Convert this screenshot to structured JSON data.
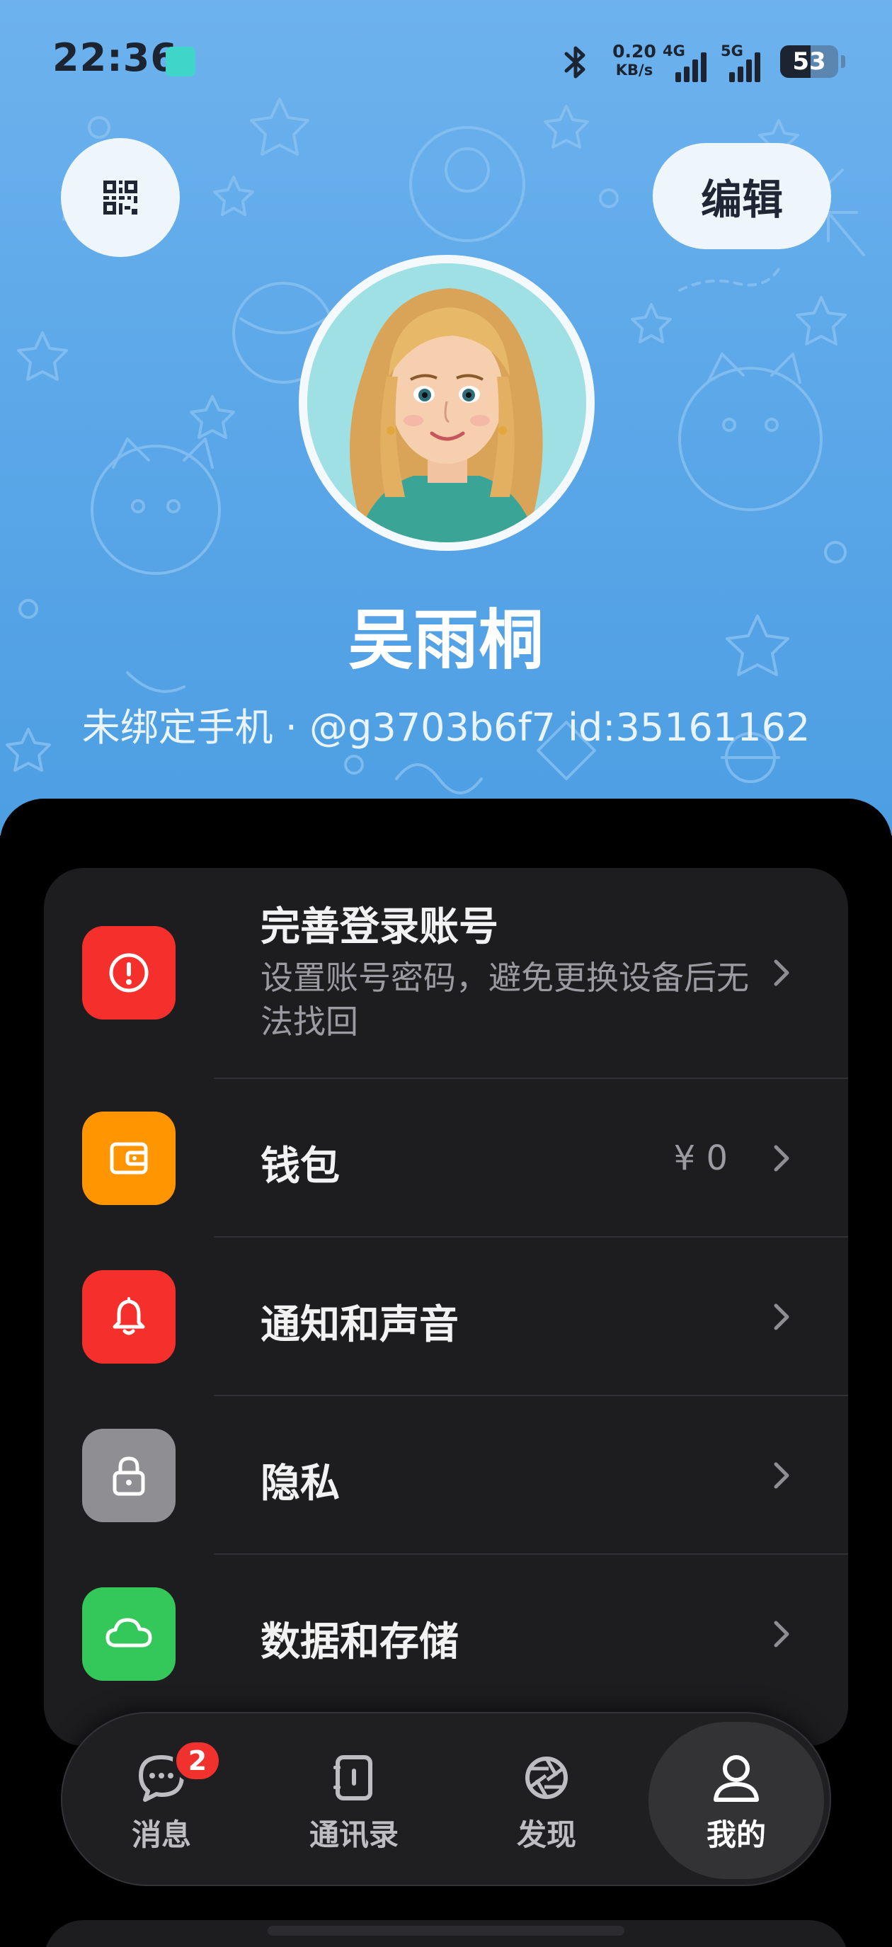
{
  "status_bar": {
    "time": "22:36",
    "net_speed_value": "0.20",
    "net_speed_unit": "KB/s",
    "signal1_label": "4G",
    "signal2_label": "5G",
    "battery_level": "53",
    "battery_fraction": 0.53
  },
  "header": {
    "qr_icon": "qr-code-icon",
    "edit_label": "编辑",
    "name": "吴雨桐",
    "subtitle": "未绑定手机 · @g3703b6f7 id:35161162",
    "background_color": "#5ba7e8"
  },
  "settings": {
    "items": [
      {
        "icon": "alert-icon",
        "color": "#f5302c",
        "title": "完善登录账号",
        "subtitle": "设置账号密码，避免更换设备后无法找回",
        "value": ""
      },
      {
        "icon": "wallet-icon",
        "color": "#ff9500",
        "title": "钱包",
        "subtitle": "",
        "value": "¥ 0"
      },
      {
        "icon": "bell-icon",
        "color": "#f5302c",
        "title": "通知和声音",
        "subtitle": "",
        "value": ""
      },
      {
        "icon": "lock-icon",
        "color": "#8e8e93",
        "title": "隐私",
        "subtitle": "",
        "value": ""
      },
      {
        "icon": "cloud-icon",
        "color": "#34c759",
        "title": "数据和存储",
        "subtitle": "",
        "value": ""
      }
    ]
  },
  "tab_bar": {
    "tabs": [
      {
        "label": "消息",
        "icon": "chat-icon",
        "badge": "2"
      },
      {
        "label": "通讯录",
        "icon": "contacts-icon"
      },
      {
        "label": "发现",
        "icon": "aperture-icon"
      },
      {
        "label": "我的",
        "icon": "person-icon",
        "active": true
      }
    ]
  }
}
